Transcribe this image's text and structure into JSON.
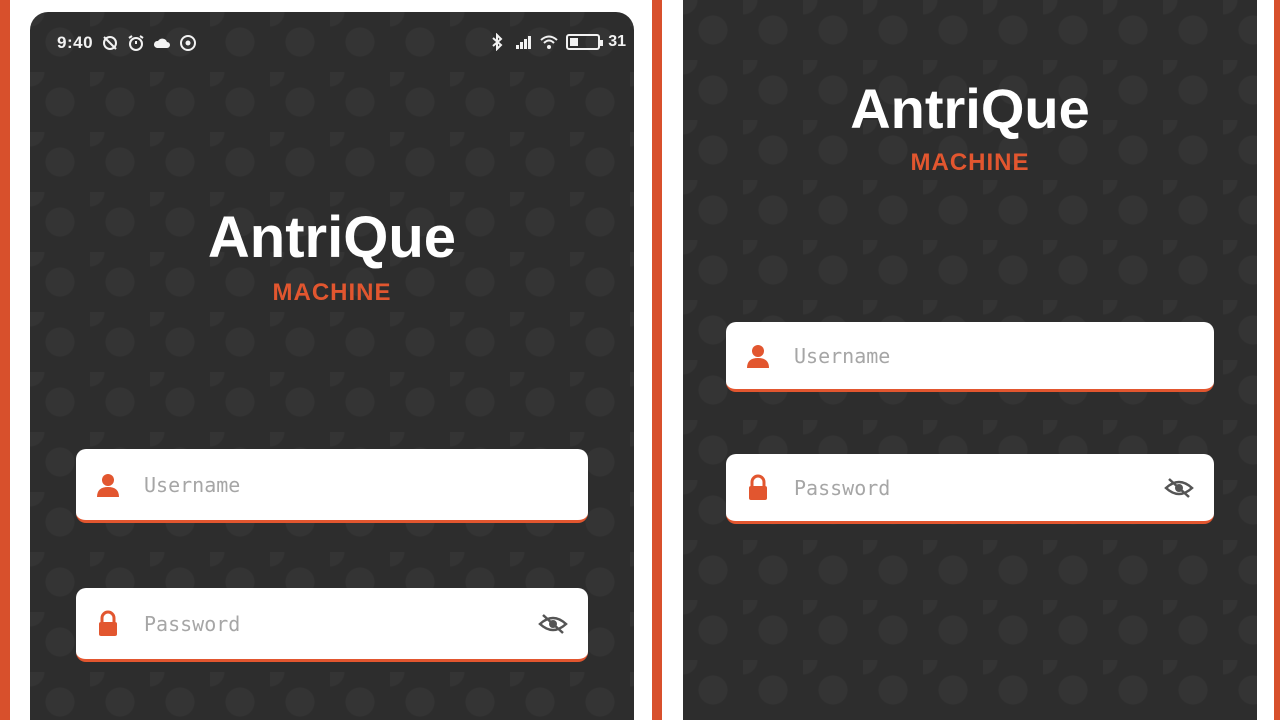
{
  "status_bar": {
    "time": "9:40",
    "battery_percent": "31",
    "battery_level": 0.31,
    "left_icons": [
      "sync-off-icon",
      "alarm-icon",
      "cloud-icon",
      "whatsapp-icon"
    ],
    "right_icons": [
      "bluetooth-icon",
      "signal-icon",
      "wifi-icon",
      "battery-icon"
    ]
  },
  "logo": {
    "word": "Antrique",
    "word_parts": [
      "Antri",
      "Q",
      "ue"
    ],
    "subtitle": "MACHINE"
  },
  "login_form": {
    "username_placeholder": "Username",
    "password_placeholder": "Password",
    "username_icon": "user-icon",
    "password_icon": "lock-icon",
    "password_toggle_icon": "eye-off-icon"
  },
  "colors": {
    "accent": "#e2562f",
    "background": "#2d2d2d",
    "frame": "#d8502c"
  }
}
